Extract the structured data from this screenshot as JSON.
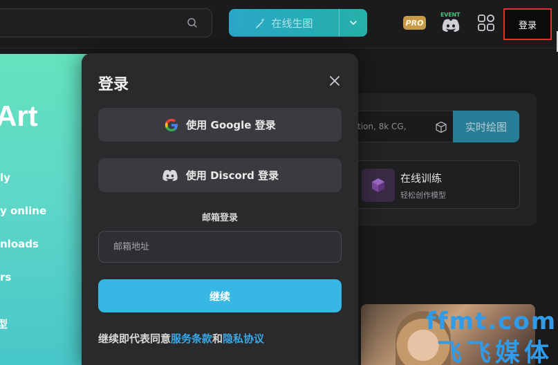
{
  "header": {
    "generate_label": "在线生图",
    "pro_badge": "PRO",
    "event_label": "EVENT",
    "login_label": "登录"
  },
  "hero": {
    "title_fragment": "Art",
    "lines": [
      "ly",
      "y online",
      "nloads",
      "rs",
      "型"
    ]
  },
  "content": {
    "prompt_fragment": "tion, 8k CG,",
    "realtime_label": "实时绘图",
    "train_title": "在线训练",
    "train_subtitle": "轻松创作模型"
  },
  "modal": {
    "title": "登录",
    "google_label": "使用 Google 登录",
    "discord_label": "使用 Discord 登录",
    "email_section_label": "邮箱登录",
    "email_placeholder": "邮箱地址",
    "continue_label": "继续",
    "terms_prefix": "继续即代表同意",
    "terms_link": "服务条款",
    "terms_and": "和",
    "privacy_link": "隐私协议"
  },
  "watermark": {
    "line1": "ffmt.com",
    "line2": "飞飞媒体"
  },
  "colors": {
    "accent": "#37b7e3",
    "login_highlight": "#e0312f",
    "link": "#3aa8e6"
  }
}
